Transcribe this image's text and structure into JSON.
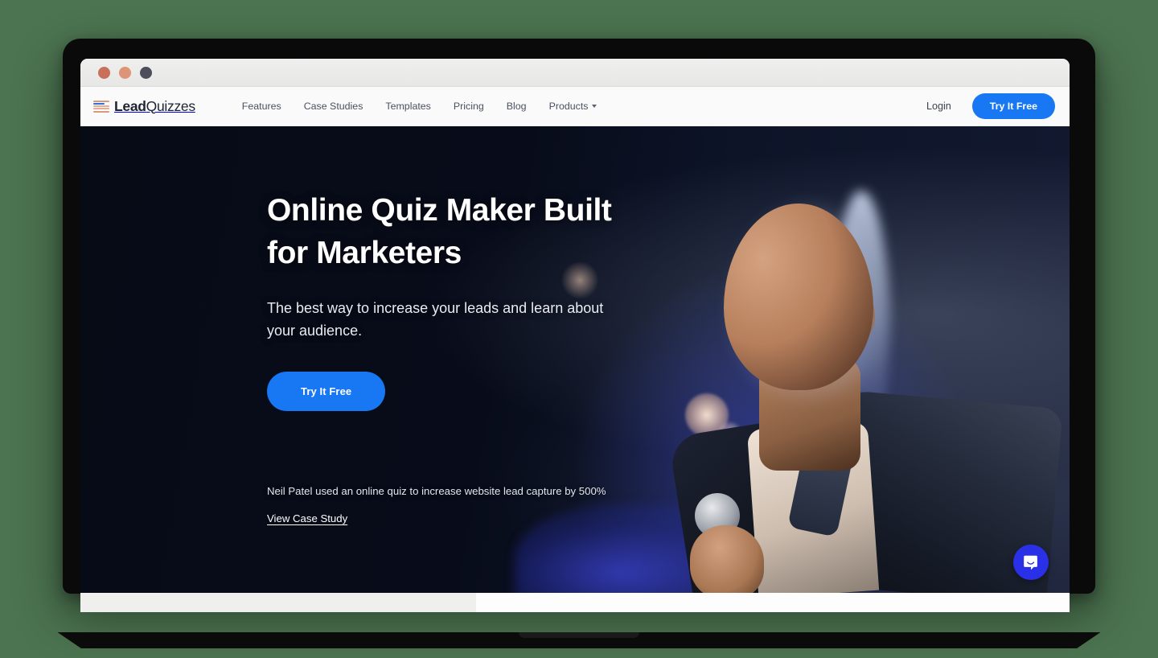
{
  "window": {
    "traffic_lights": [
      "close",
      "minimize",
      "zoom"
    ],
    "colors": {
      "background": "#4c7450",
      "titlebar": "#ececec"
    }
  },
  "header": {
    "brand": {
      "bold": "Lead",
      "regular": "Quizzes",
      "mark_icon": "leadquizzes-logo-icon"
    },
    "nav": [
      {
        "label": "Features",
        "has_caret": false
      },
      {
        "label": "Case Studies",
        "has_caret": false
      },
      {
        "label": "Templates",
        "has_caret": false
      },
      {
        "label": "Pricing",
        "has_caret": false
      },
      {
        "label": "Blog",
        "has_caret": false
      },
      {
        "label": "Products",
        "has_caret": true
      }
    ],
    "login_label": "Login",
    "cta_label": "Try It Free",
    "accent_color": "#1877f2"
  },
  "hero": {
    "title_line1": "Online Quiz Maker Built",
    "title_line2": "for Marketers",
    "subtitle": "The best way to increase your leads and learn about your audience.",
    "cta_label": "Try It Free",
    "proof_text": "Neil Patel used an online quiz to increase website lead capture by 500%",
    "proof_link_label": "View Case Study",
    "background_color": "#090d1b",
    "photo_subject": "man-speaking-into-microphone"
  },
  "chat": {
    "icon": "intercom-chat-bubble-icon",
    "color": "#2a30e8"
  }
}
